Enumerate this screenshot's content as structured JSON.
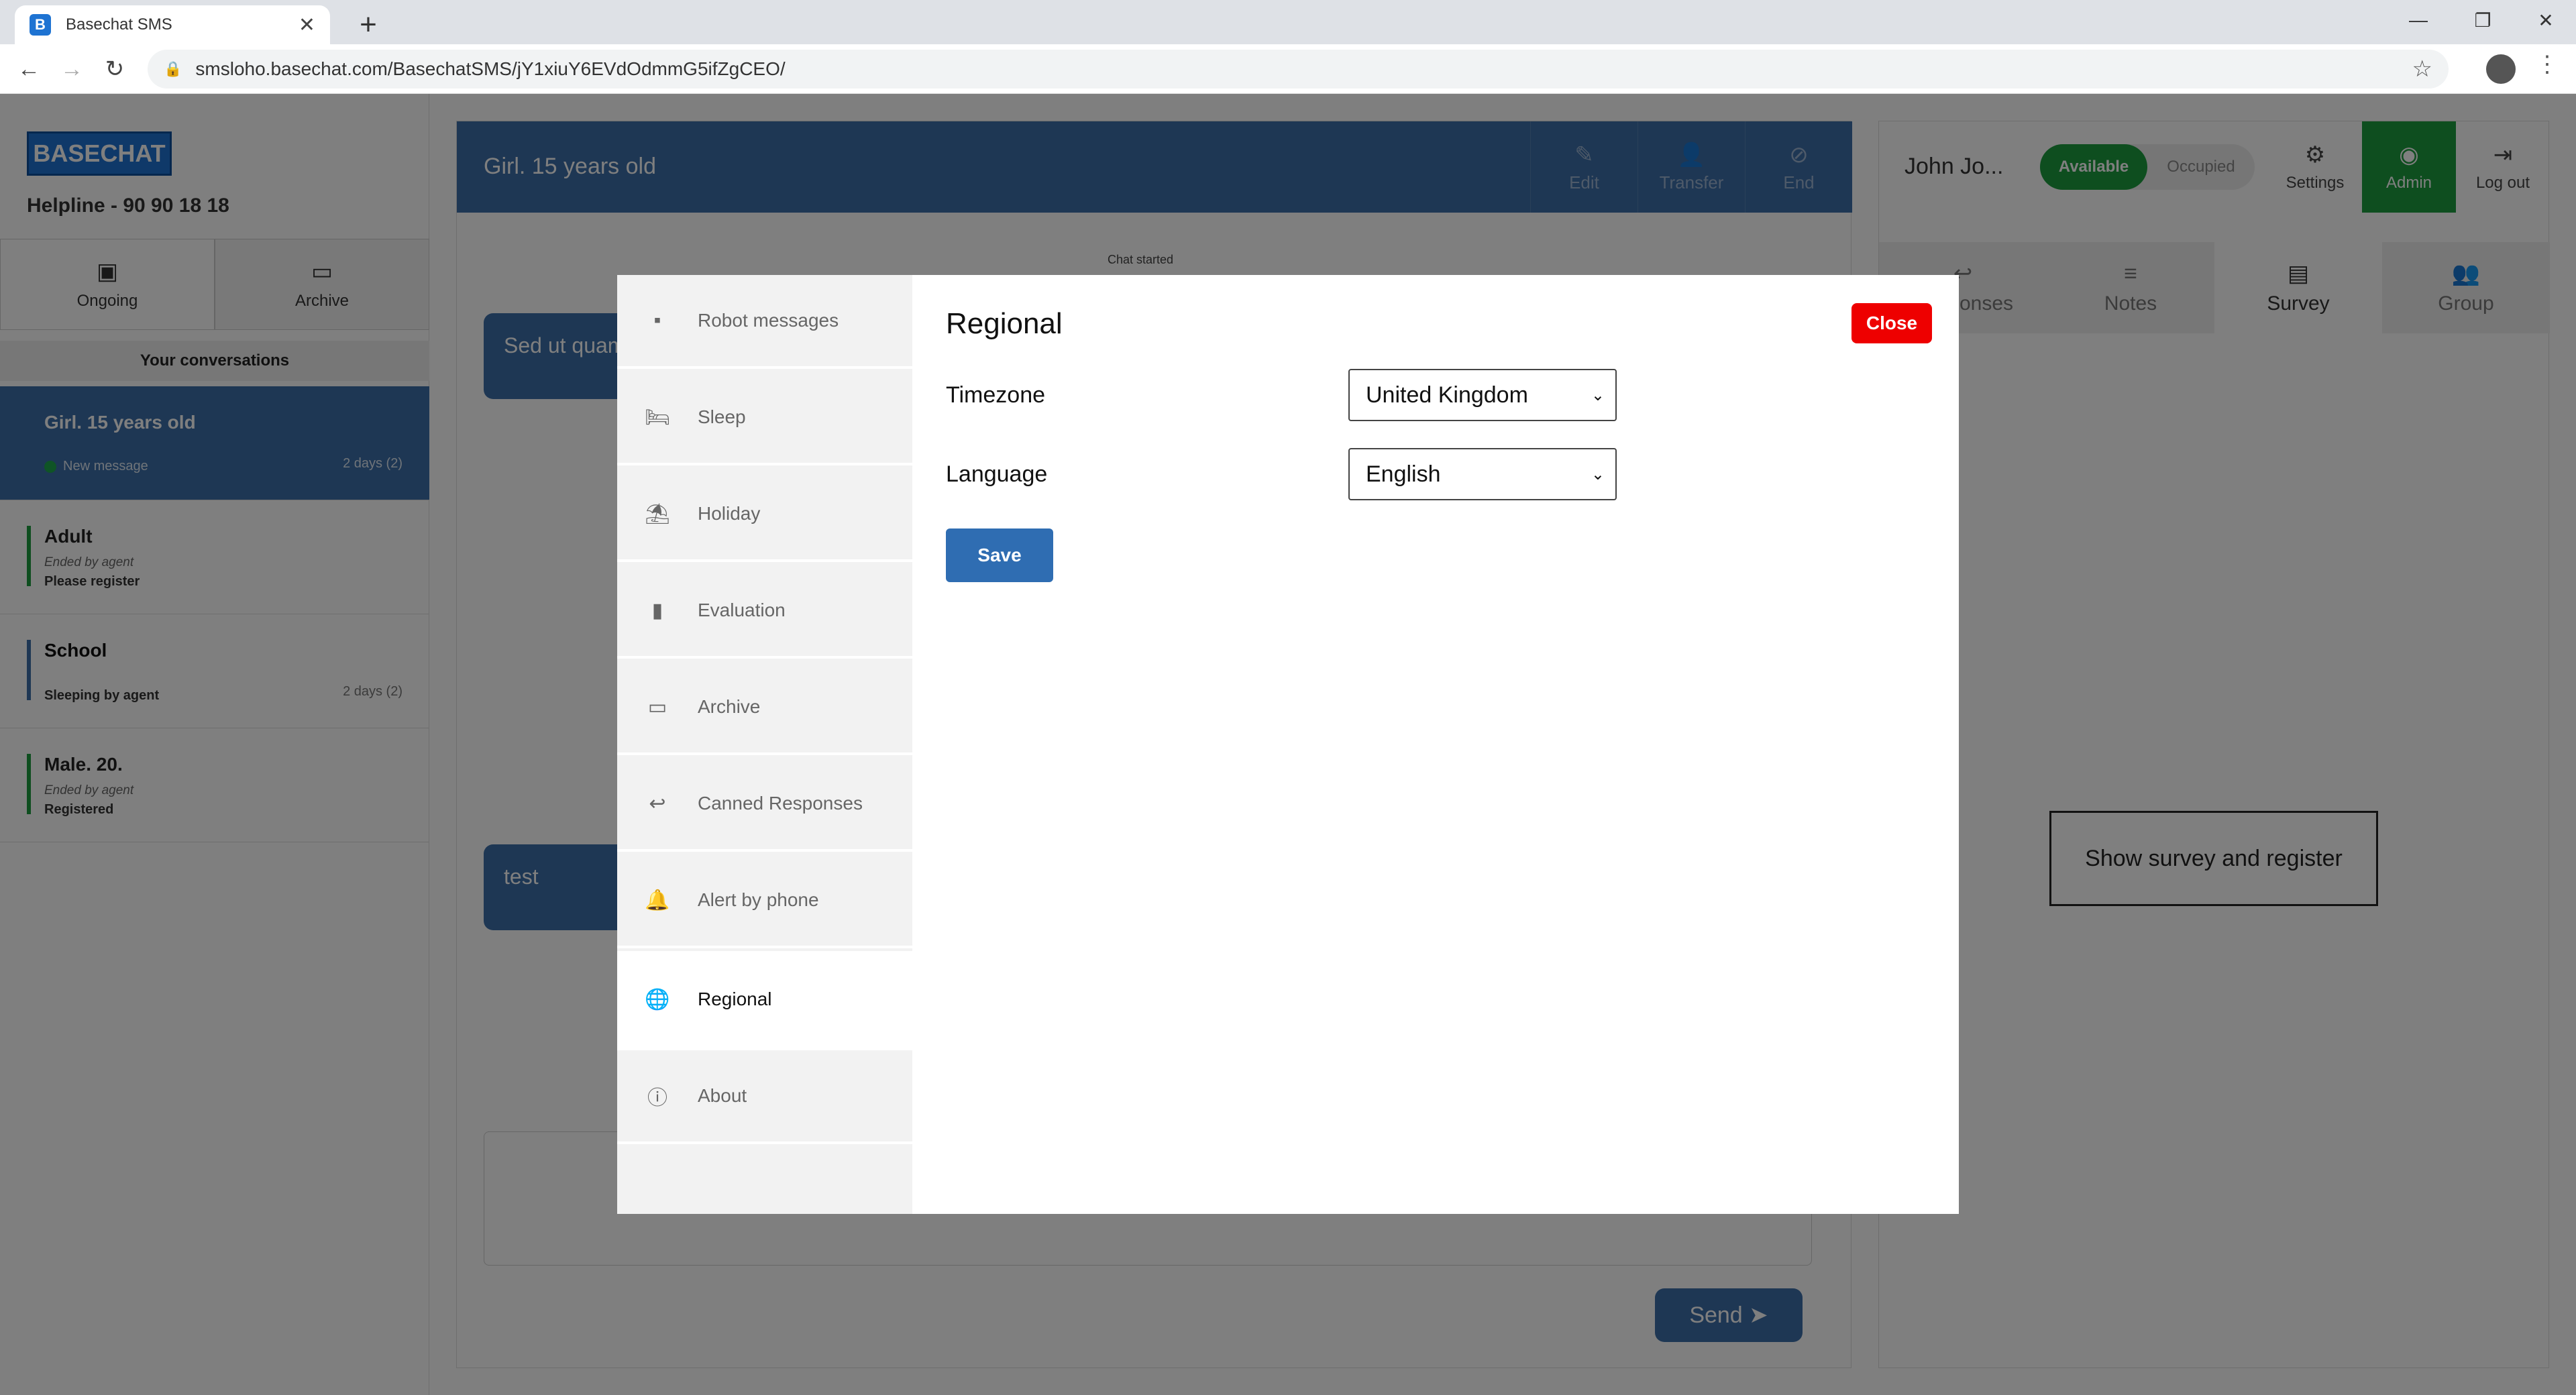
{
  "browser": {
    "tab_title": "Basechat SMS",
    "favicon_letter": "B",
    "url": "smsloho.basechat.com/BasechatSMS/jY1xiuY6EVdOdmmG5ifZgCEO/"
  },
  "sidebar": {
    "logo": "BASECHAT",
    "helpline": "Helpline - 90 90 18 18",
    "tabs": [
      {
        "label": "Ongoing"
      },
      {
        "label": "Archive"
      }
    ],
    "conversations_header": "Your conversations",
    "conversations": [
      {
        "name": "Girl. 15 years old",
        "sub1": "",
        "sub2": "New message",
        "time": "2 days (2)"
      },
      {
        "name": "Adult",
        "sub1": "Ended by agent",
        "sub2": "Please register",
        "time": ""
      },
      {
        "name": "School",
        "sub1": "",
        "sub2": "Sleeping by agent",
        "time": "2 days (2)"
      },
      {
        "name": "Male. 20.",
        "sub1": "Ended by agent",
        "sub2": "Registered",
        "time": ""
      }
    ]
  },
  "chat": {
    "title": "Girl. 15 years old",
    "actions": [
      {
        "label": "Edit"
      },
      {
        "label": "Transfer"
      },
      {
        "label": "End"
      }
    ],
    "started_label": "Chat started",
    "messages": [
      {
        "text": "Sed ut quam"
      },
      {
        "text": "test"
      }
    ],
    "send_label": "Send"
  },
  "agent": {
    "name": "John Jo...",
    "available_label": "Available",
    "occupied_label": "Occupied",
    "settings_label": "Settings",
    "admin_label": "Admin",
    "logout_label": "Log out",
    "tabs": [
      {
        "label": "Responses"
      },
      {
        "label": "Notes"
      },
      {
        "label": "Survey"
      },
      {
        "label": "Group"
      }
    ],
    "survey_button": "Show survey and register"
  },
  "modal": {
    "menu": [
      {
        "label": "Robot messages",
        "icon": "chat-bubble-icon"
      },
      {
        "label": "Sleep",
        "icon": "bed-icon"
      },
      {
        "label": "Holiday",
        "icon": "beach-umbrella-icon"
      },
      {
        "label": "Evaluation",
        "icon": "bar-chart-icon"
      },
      {
        "label": "Archive",
        "icon": "folder-icon"
      },
      {
        "label": "Canned Responses",
        "icon": "reply-icon"
      },
      {
        "label": "Alert by phone",
        "icon": "bell-icon"
      },
      {
        "label": "Regional",
        "icon": "globe-icon"
      },
      {
        "label": "About",
        "icon": "info-icon"
      }
    ],
    "title": "Regional",
    "close_label": "Close",
    "timezone_label": "Timezone",
    "timezone_value": "United Kingdom",
    "language_label": "Language",
    "language_value": "English",
    "save_label": "Save"
  },
  "colors": {
    "brand_blue": "#3c6ea8",
    "available_green": "#1c9c3f",
    "close_red": "#ee0000",
    "save_blue": "#2f6db2"
  }
}
